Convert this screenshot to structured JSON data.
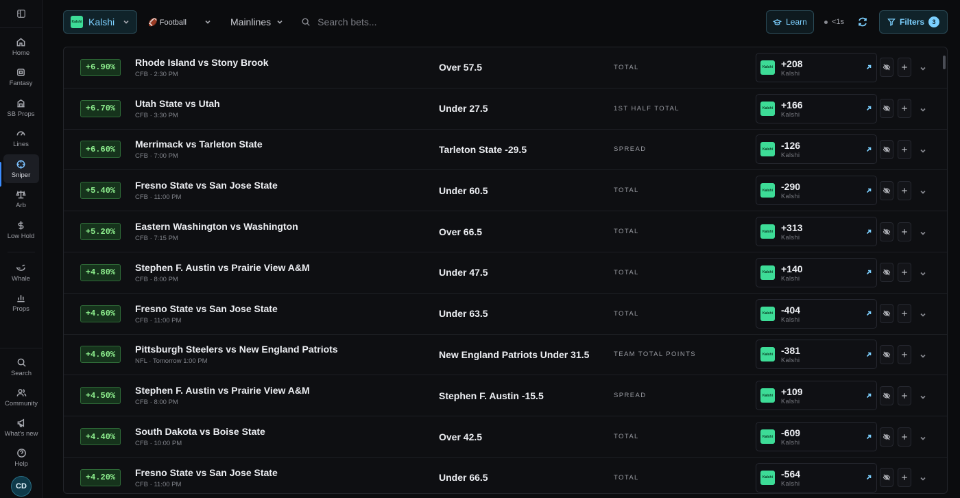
{
  "sidebar": {
    "items": [
      {
        "label": "Home",
        "icon": "home-icon"
      },
      {
        "label": "Fantasy",
        "icon": "fantasy-icon"
      },
      {
        "label": "SB Props",
        "icon": "sb-props-icon"
      },
      {
        "label": "Lines",
        "icon": "lines-icon"
      },
      {
        "label": "Sniper",
        "icon": "crosshair-icon",
        "active": true
      },
      {
        "label": "Arb",
        "icon": "scale-icon"
      },
      {
        "label": "Low Hold",
        "icon": "dollar-icon"
      },
      {
        "label": "Whale",
        "icon": "whale-icon"
      },
      {
        "label": "Props",
        "icon": "bar-chart-icon"
      }
    ],
    "bottom": [
      {
        "label": "Search",
        "icon": "search-icon"
      },
      {
        "label": "Community",
        "icon": "users-icon"
      },
      {
        "label": "What's new",
        "icon": "megaphone-icon"
      },
      {
        "label": "Help",
        "icon": "help-icon"
      }
    ],
    "avatar": "CD"
  },
  "topbar": {
    "book_logo": "Kalshi",
    "book": "Kalshi",
    "sport": "🏈 Football",
    "market": "Mainlines",
    "search_placeholder": "Search bets...",
    "learn": "Learn",
    "updated": "<1s",
    "filters": "Filters",
    "filters_count": "3"
  },
  "rows": [
    {
      "ev": "+6.90%",
      "game": "Rhode Island vs Stony Brook",
      "meta": "CFB · 2:30 PM",
      "pick": "Over 57.5",
      "market": "TOTAL",
      "price": "+208",
      "book": "Kalshi"
    },
    {
      "ev": "+6.70%",
      "game": "Utah State vs Utah",
      "meta": "CFB · 3:30 PM",
      "pick": "Under 27.5",
      "market": "1ST HALF TOTAL",
      "price": "+166",
      "book": "Kalshi"
    },
    {
      "ev": "+6.60%",
      "game": "Merrimack vs Tarleton State",
      "meta": "CFB · 7:00 PM",
      "pick": "Tarleton State -29.5",
      "market": "SPREAD",
      "price": "-126",
      "book": "Kalshi"
    },
    {
      "ev": "+5.40%",
      "game": "Fresno State vs San Jose State",
      "meta": "CFB · 11:00 PM",
      "pick": "Under 60.5",
      "market": "TOTAL",
      "price": "-290",
      "book": "Kalshi"
    },
    {
      "ev": "+5.20%",
      "game": "Eastern Washington vs Washington",
      "meta": "CFB · 7:15 PM",
      "pick": "Over 66.5",
      "market": "TOTAL",
      "price": "+313",
      "book": "Kalshi"
    },
    {
      "ev": "+4.80%",
      "game": "Stephen F. Austin vs Prairie View A&M",
      "meta": "CFB · 8:00 PM",
      "pick": "Under 47.5",
      "market": "TOTAL",
      "price": "+140",
      "book": "Kalshi"
    },
    {
      "ev": "+4.60%",
      "game": "Fresno State vs San Jose State",
      "meta": "CFB · 11:00 PM",
      "pick": "Under 63.5",
      "market": "TOTAL",
      "price": "-404",
      "book": "Kalshi"
    },
    {
      "ev": "+4.60%",
      "game": "Pittsburgh Steelers vs New England Patriots",
      "meta": "NFL · Tomorrow 1:00 PM",
      "pick": "New England Patriots Under 31.5",
      "market": "TEAM TOTAL POINTS",
      "price": "-381",
      "book": "Kalshi"
    },
    {
      "ev": "+4.50%",
      "game": "Stephen F. Austin vs Prairie View A&M",
      "meta": "CFB · 8:00 PM",
      "pick": "Stephen F. Austin -15.5",
      "market": "SPREAD",
      "price": "+109",
      "book": "Kalshi"
    },
    {
      "ev": "+4.40%",
      "game": "South Dakota vs Boise State",
      "meta": "CFB · 10:00 PM",
      "pick": "Over 42.5",
      "market": "TOTAL",
      "price": "-609",
      "book": "Kalshi"
    },
    {
      "ev": "+4.20%",
      "game": "Fresno State vs San Jose State",
      "meta": "CFB · 11:00 PM",
      "pick": "Under 66.5",
      "market": "TOTAL",
      "price": "-564",
      "book": "Kalshi"
    }
  ]
}
